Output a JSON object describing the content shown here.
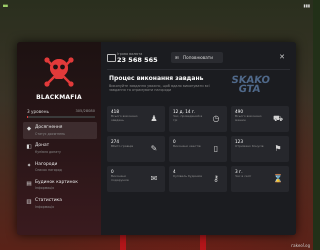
{
  "hud": {
    "bottom": "rakeolog"
  },
  "profile": {
    "name": "BLACKMAFIA",
    "level": "3 уровень",
    "xp": "305/28080",
    "xp_progress": 0.011
  },
  "menu": [
    {
      "icon": "achievements-icon",
      "glyph": "◆",
      "title": "Досягнення",
      "sub": "Статус досягнень",
      "active": true
    },
    {
      "icon": "donate-icon",
      "glyph": "◧",
      "title": "Донат",
      "sub": "Купівля донату",
      "active": false
    },
    {
      "icon": "rewards-icon",
      "glyph": "✦",
      "title": "Нагороди",
      "sub": "Список нагород",
      "active": false
    },
    {
      "icon": "cards-icon",
      "glyph": "▤",
      "title": "Будинок картинок",
      "sub": "Інформація",
      "active": false
    },
    {
      "icon": "stats-icon",
      "glyph": "▥",
      "title": "Статистика",
      "sub": "Інформація",
      "active": false
    }
  ],
  "header": {
    "balance_label": "Ігрова валюта",
    "balance": "23 568 565",
    "topup_label": "Поповнювати"
  },
  "tasks": {
    "title": "Процес виконання завдань",
    "description": "Виконуйте завдання уважно, щоб вдало виконувати всі завдання та отримувати нагороди",
    "watermark": "SKAKO GTA",
    "cards": [
      {
        "value": "418",
        "label": "Всього виконано завдань",
        "icon": "person-icon",
        "glyph": "♟"
      },
      {
        "value": "12 д. 14 г.",
        "label": "Час, проведений в грі",
        "icon": "clock-icon",
        "glyph": "◷"
      },
      {
        "value": "490",
        "label": "Всього виконано машин",
        "icon": "car-icon",
        "glyph": "⛟"
      },
      {
        "value": "274",
        "label": "Вбито гравців",
        "icon": "gun-icon",
        "glyph": "✎"
      },
      {
        "value": "0",
        "label": "Виконано квестів",
        "icon": "book-icon",
        "glyph": "▯"
      },
      {
        "value": "123",
        "label": "Отримано бонусів",
        "icon": "flag-icon",
        "glyph": "⚑"
      },
      {
        "value": "0",
        "label": "Виконано подарунків",
        "icon": "gift-icon",
        "glyph": "✉"
      },
      {
        "value": "4",
        "label": "Купівель будинків",
        "icon": "key-icon",
        "glyph": "⚷"
      },
      {
        "value": "3 г.",
        "label": "Час в сесії",
        "icon": "timer-icon",
        "glyph": "⌛"
      }
    ]
  }
}
